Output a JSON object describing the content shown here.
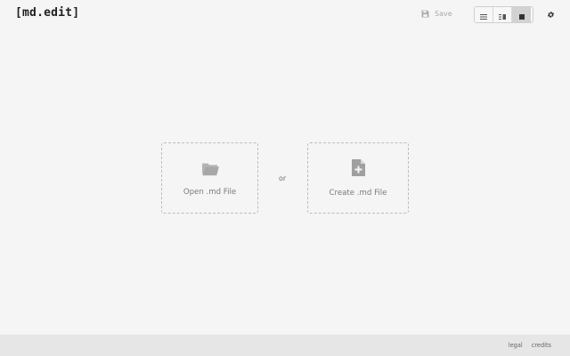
{
  "header": {
    "brand": "[md.edit]",
    "save_label": "Save",
    "save_icon": "save-icon",
    "view_modes": [
      {
        "name": "editor-only",
        "icon": "editor-only-icon"
      },
      {
        "name": "split",
        "icon": "split-icon"
      },
      {
        "name": "preview-only",
        "icon": "preview-only-icon",
        "active": true
      }
    ],
    "settings_icon": "gear-icon"
  },
  "main": {
    "open_label": "Open .md File",
    "open_icon": "folder-open-icon",
    "separator": "or",
    "create_label": "Create .md File",
    "create_icon": "file-plus-icon"
  },
  "footer": {
    "links": [
      "legal",
      "credits"
    ]
  },
  "colors": {
    "background": "#f5f5f5",
    "footer": "#e6e6e6",
    "text_muted": "#7a7a7a",
    "active_toggle": "#d2d2d2"
  }
}
